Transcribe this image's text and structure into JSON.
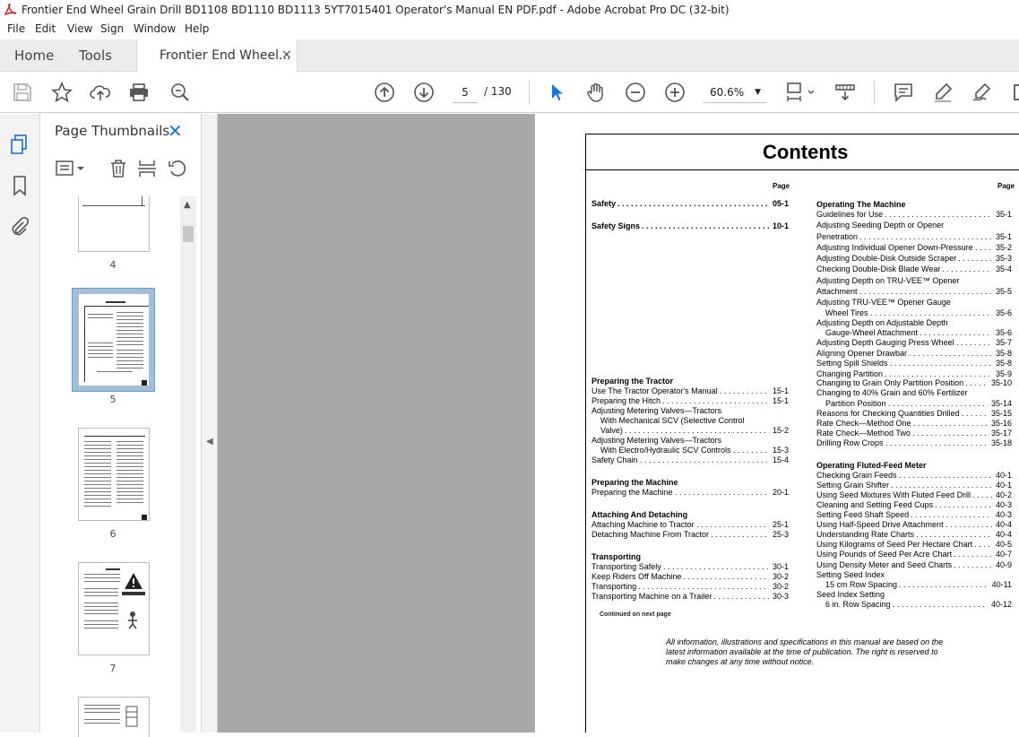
{
  "window": {
    "title": "Frontier End Wheel Grain Drill BD1108 BD1110 BD1113 5YT7015401 Operator's Manual EN PDF.pdf - Adobe Acrobat Pro DC (32-bit)"
  },
  "menu": [
    "File",
    "Edit",
    "View",
    "Sign",
    "Window",
    "Help"
  ],
  "tabs": {
    "home": "Home",
    "tools": "Tools",
    "document": "Frontier End Wheel...",
    "close": "×"
  },
  "toolbar": {
    "page_current": "5",
    "page_total": "/ 130",
    "zoom": "60.6%"
  },
  "thumbnails": {
    "title": "Page Thumbnails",
    "close": "✕",
    "pages": [
      "4",
      "5",
      "6",
      "7"
    ]
  },
  "colors": {
    "accent": "#1473e6",
    "viewer_bg": "#a9a9a9"
  },
  "document": {
    "heading": "Contents",
    "page_label": "Page",
    "continued": "Continued on next page",
    "footnote": "All information, illustrations and specifications in this manual are based on the latest information available at the time of publication. The right is reserved to make changes at any time without notice.",
    "left_column": [
      {
        "text": "Safety",
        "page": "05-1",
        "bold": true
      },
      {
        "text": "Safety Signs",
        "page": "10-1",
        "bold": true
      },
      {
        "text": "Preparing the Tractor",
        "bold": true
      },
      {
        "text": "Use The Tractor Operator's Manual",
        "page": "15-1"
      },
      {
        "text": "Preparing the Hitch",
        "page": "15-1"
      },
      {
        "text": "Adjusting Metering Valves—Tractors"
      },
      {
        "text": "With Mechanical SCV (Selective Control",
        "indent": true
      },
      {
        "text": "Valve)",
        "page": "15-2",
        "indent": true
      },
      {
        "text": "Adjusting Metering Valves—Tractors"
      },
      {
        "text": "With Electro/Hydraulic SCV Controls",
        "page": "15-3",
        "indent": true
      },
      {
        "text": "Safety Chain",
        "page": "15-4"
      },
      {
        "text": "Preparing the Machine",
        "bold": true
      },
      {
        "text": "Preparing the Machine",
        "page": "20-1"
      },
      {
        "text": "Attaching And Detaching",
        "bold": true
      },
      {
        "text": "Attaching Machine to Tractor",
        "page": "25-1"
      },
      {
        "text": "Detaching Machine From Tractor",
        "page": "25-3"
      },
      {
        "text": "Transporting",
        "bold": true
      },
      {
        "text": "Transporting Safely",
        "page": "30-1"
      },
      {
        "text": "Keep Riders Off Machine",
        "page": "30-2"
      },
      {
        "text": "Transporting",
        "page": "30-2"
      },
      {
        "text": "Transporting Machine on a Trailer",
        "page": "30-3"
      }
    ],
    "right_column": [
      {
        "text": "Operating The Machine",
        "bold": true
      },
      {
        "text": "Guidelines for Use",
        "page": "35-1"
      },
      {
        "text": "Adjusting Seeding Depth or Opener"
      },
      {
        "text": "Penetration",
        "page": "35-1"
      },
      {
        "text": "Adjusting Individual Opener Down-Pressure",
        "page": "35-2"
      },
      {
        "text": "Adjusting Double-Disk Outside Scraper",
        "page": "35-3"
      },
      {
        "text": "Checking Double-Disk Blade Wear",
        "page": "35-4"
      },
      {
        "text": "Adjusting Depth on TRU-VEE™ Opener"
      },
      {
        "text": "Attachment",
        "page": "35-5"
      },
      {
        "text": "Adjusting TRU-VEE™ Opener Gauge"
      },
      {
        "text": "Wheel Tires",
        "page": "35-6",
        "indent": true
      },
      {
        "text": "Adjusting Depth on Adjustable Depth"
      },
      {
        "text": "Gauge-Wheel Attachment",
        "page": "35-6",
        "indent": true
      },
      {
        "text": "Adjusting Depth Gauging Press Wheel",
        "page": "35-7"
      },
      {
        "text": "Aligning Opener Drawbar",
        "page": "35-8"
      },
      {
        "text": "Setting Spill Shields",
        "page": "35-8"
      },
      {
        "text": "Changing Partition",
        "page": "35-9"
      },
      {
        "text": "Changing to Grain Only Partition Position",
        "page": "35-10"
      },
      {
        "text": "Changing to 40% Grain and 60% Fertilizer"
      },
      {
        "text": "Partition Position",
        "page": "35-14",
        "indent": true
      },
      {
        "text": "Reasons for Checking Quantities Drilled",
        "page": "35-15"
      },
      {
        "text": "Rate Check—Method One",
        "page": "35-16"
      },
      {
        "text": "Rate Check—Method Two",
        "page": "35-17"
      },
      {
        "text": "Drilling Row Crops",
        "page": "35-18"
      },
      {
        "text": "Operating Fluted-Feed Meter",
        "bold": true
      },
      {
        "text": "Checking Grain Feeds",
        "page": "40-1"
      },
      {
        "text": "Setting Grain Shifter",
        "page": "40-1"
      },
      {
        "text": "Using Seed Mixtures With Fluted Feed Drill",
        "page": "40-2"
      },
      {
        "text": "Cleaning and Setting Feed Cups",
        "page": "40-3"
      },
      {
        "text": "Setting Feed Shaft Speed",
        "page": "40-3"
      },
      {
        "text": "Using Half-Speed Drive Attachment",
        "page": "40-4"
      },
      {
        "text": "Understanding Rate Charts",
        "page": "40-4"
      },
      {
        "text": "Using Kilograms of Seed Per Hectare Chart",
        "page": "40-5"
      },
      {
        "text": "Using Pounds of Seed Per Acre Chart",
        "page": "40-7"
      },
      {
        "text": "Using Density Meter and Seed Charts",
        "page": "40-9"
      },
      {
        "text": "Setting Seed Index"
      },
      {
        "text": "15 cm Row Spacing",
        "page": "40-11",
        "indent": true
      },
      {
        "text": "Seed Index Setting"
      },
      {
        "text": "6 in. Row Spacing",
        "page": "40-12",
        "indent": true
      }
    ]
  }
}
